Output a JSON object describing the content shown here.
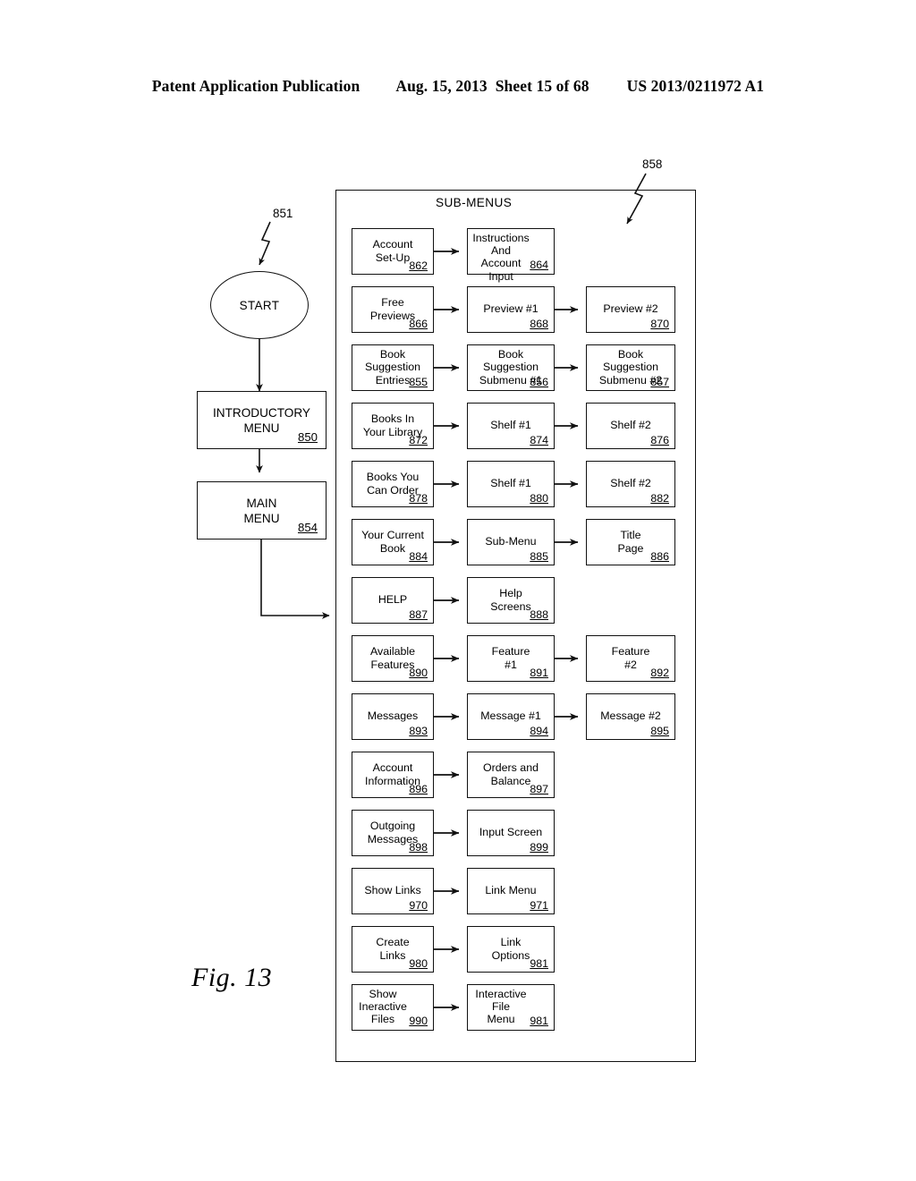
{
  "header": {
    "publication": "Patent Application Publication",
    "date": "Aug. 15, 2013",
    "sheet": "Sheet 15 of 68",
    "number": "US 2013/0211972 A1"
  },
  "figure": {
    "label": "Fig. 13",
    "container_title": "SUB-MENUS",
    "container_ref": "858",
    "start_ref": "851"
  },
  "flow": {
    "start": {
      "label": "START"
    },
    "intro_menu": {
      "lines": "INTRODUCTORY\nMENU",
      "ref": "850"
    },
    "main_menu": {
      "lines": "MAIN\nMENU",
      "ref": "854"
    }
  },
  "rows": [
    {
      "col1": {
        "lines": "Account\nSet-Up",
        "ref": "862",
        "inline": false
      },
      "col2": {
        "lines": "Instructions\nAnd Account\nInput",
        "ref": "864",
        "inline": true
      },
      "col3": null
    },
    {
      "col1": {
        "lines": "Free\nPreviews",
        "ref": "866",
        "inline": false
      },
      "col2": {
        "lines": "Preview #1",
        "ref": "868",
        "inline": false
      },
      "col3": {
        "lines": "Preview #2",
        "ref": "870",
        "inline": false
      }
    },
    {
      "col1": {
        "lines": "Book\nSuggestion\nEntries",
        "ref": "855",
        "inline": false
      },
      "col2": {
        "lines": "Book\nSuggestion\nSubmenu #1",
        "ref": "856",
        "inline": false
      },
      "col3": {
        "lines": "Book\nSuggestion\nSubmenu #2",
        "ref": "857",
        "inline": false
      }
    },
    {
      "col1": {
        "lines": "Books In\nYour Library",
        "ref": "872",
        "inline": false
      },
      "col2": {
        "lines": "Shelf #1",
        "ref": "874",
        "inline": false
      },
      "col3": {
        "lines": "Shelf #2",
        "ref": "876",
        "inline": false
      }
    },
    {
      "col1": {
        "lines": "Books You\nCan Order",
        "ref": "878",
        "inline": false
      },
      "col2": {
        "lines": "Shelf #1",
        "ref": "880",
        "inline": false
      },
      "col3": {
        "lines": "Shelf #2",
        "ref": "882",
        "inline": false
      }
    },
    {
      "col1": {
        "lines": "Your Current\nBook",
        "ref": "884",
        "inline": false
      },
      "col2": {
        "lines": "Sub-Menu",
        "ref": "885",
        "inline": false
      },
      "col3": {
        "lines": "Title\nPage",
        "ref": "886",
        "inline": false
      }
    },
    {
      "col1": {
        "lines": "HELP",
        "ref": "887",
        "inline": false
      },
      "col2": {
        "lines": "Help\nScreens",
        "ref": "888",
        "inline": false
      },
      "col3": null
    },
    {
      "col1": {
        "lines": "Available\nFeatures",
        "ref": "890",
        "inline": false
      },
      "col2": {
        "lines": "Feature\n#1",
        "ref": "891",
        "inline": false
      },
      "col3": {
        "lines": "Feature\n#2",
        "ref": "892",
        "inline": false
      }
    },
    {
      "col1": {
        "lines": "Messages",
        "ref": "893",
        "inline": false
      },
      "col2": {
        "lines": "Message #1",
        "ref": "894",
        "inline": false
      },
      "col3": {
        "lines": "Message #2",
        "ref": "895",
        "inline": false
      }
    },
    {
      "col1": {
        "lines": "Account\nInformation",
        "ref": "896",
        "inline": false
      },
      "col2": {
        "lines": "Orders and\nBalance",
        "ref": "897",
        "inline": false
      },
      "col3": null
    },
    {
      "col1": {
        "lines": "Outgoing\nMessages",
        "ref": "898",
        "inline": false
      },
      "col2": {
        "lines": "Input Screen",
        "ref": "899",
        "inline": false
      },
      "col3": null
    },
    {
      "col1": {
        "lines": "Show Links",
        "ref": "970",
        "inline": false
      },
      "col2": {
        "lines": "Link Menu",
        "ref": "971",
        "inline": false
      },
      "col3": null
    },
    {
      "col1": {
        "lines": "Create\nLinks",
        "ref": "980",
        "inline": false
      },
      "col2": {
        "lines": "Link\nOptions",
        "ref": "981",
        "inline": false
      },
      "col3": null
    },
    {
      "col1": {
        "lines": "Show\nIneractive\nFiles",
        "ref": "990",
        "inline": true
      },
      "col2": {
        "lines": "Interactive\nFile\nMenu",
        "ref": "981",
        "inline": true
      },
      "col3": null
    }
  ]
}
